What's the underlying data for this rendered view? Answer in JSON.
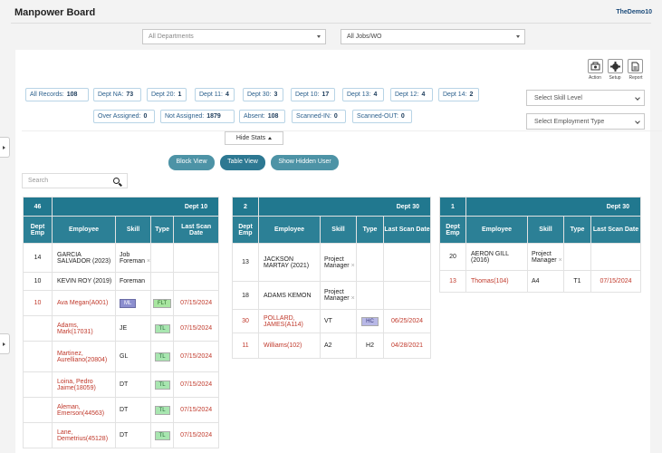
{
  "header": {
    "title": "Manpower Board",
    "user": "TheDemo10"
  },
  "filters": {
    "departments": "All Departments",
    "jobs": "All Jobs/WO"
  },
  "toolbar": {
    "action": "Action",
    "setup": "Setup",
    "report": "Report"
  },
  "stats": [
    {
      "label": "All Records:",
      "value": "108"
    },
    {
      "label": "Dept NA:",
      "value": "73"
    },
    {
      "label": "Dept 20:",
      "value": "1"
    },
    {
      "label": "Dept 11:",
      "value": "4"
    },
    {
      "label": "Dept 30:",
      "value": "3"
    },
    {
      "label": "Dept 10:",
      "value": "17"
    },
    {
      "label": "Dept 13:",
      "value": "4"
    },
    {
      "label": "Dept 12:",
      "value": "4"
    },
    {
      "label": "Dept 14:",
      "value": "2"
    },
    {
      "label": "Over Assigned:",
      "value": "0"
    },
    {
      "label": "Not Assigned:",
      "value": "1879"
    },
    {
      "label": "Absent:",
      "value": "108"
    },
    {
      "label": "Scanned-IN:",
      "value": "0"
    },
    {
      "label": "Scanned-OUT:",
      "value": "0"
    }
  ],
  "skill_level": "Select Skill Level",
  "employment_type": "Select Employment Type",
  "hide_stats": "Hide Stats",
  "views": {
    "block": "Block View",
    "table": "Table View",
    "hidden": "Show Hidden User"
  },
  "search": {
    "placeholder": "Search"
  },
  "columns": {
    "dept_emp": "Dept Emp",
    "employee": "Employee",
    "skill": "Skill",
    "type": "Type",
    "last_scan": "Last Scan Date"
  },
  "tables": [
    {
      "count": "46",
      "dept": "Dept 10",
      "rows": [
        {
          "emp": "14",
          "name": "GARCIA SALVADOR (2023)",
          "skill": "Job Foreman",
          "x": true,
          "type": "",
          "date": "",
          "red": false
        },
        {
          "emp": "10",
          "name": "KEVIN ROY (2019)",
          "skill": "Foreman",
          "x": false,
          "type": "",
          "date": "",
          "red": false
        },
        {
          "emp": "10",
          "name": "Ava Megan(A001)",
          "skill": "ML",
          "skilltag": "ml",
          "type": "FLT",
          "typetag": "ft",
          "date": "07/15/2024",
          "red": true
        },
        {
          "emp": "",
          "name": "Adams, Mark(17031)",
          "skill": "JE",
          "type": "TL",
          "typetag": "tl",
          "date": "07/15/2024",
          "red": true
        },
        {
          "emp": "",
          "name": "Martinez, Aurelliano(20804)",
          "skill": "GL",
          "type": "TL",
          "typetag": "tl",
          "date": "07/15/2024",
          "red": true
        },
        {
          "emp": "",
          "name": "Loina, Pedro Jaime(18059)",
          "skill": "DT",
          "type": "TL",
          "typetag": "tl",
          "date": "07/15/2024",
          "red": true
        },
        {
          "emp": "",
          "name": "Aleman, Emerson(44563)",
          "skill": "DT",
          "type": "TL",
          "typetag": "tl",
          "date": "07/15/2024",
          "red": true
        },
        {
          "emp": "",
          "name": "Lane, Demetrius(45128)",
          "skill": "DT",
          "type": "TL",
          "typetag": "tl",
          "date": "07/15/2024",
          "red": true
        }
      ]
    },
    {
      "count": "2",
      "dept": "Dept 30",
      "rows": [
        {
          "emp": "13",
          "name": "JACKSON MARTAY (2021)",
          "skill": "Project Manager",
          "x": true,
          "type": "",
          "date": "",
          "red": false
        },
        {
          "emp": "18",
          "name": "ADAMS KEMON",
          "skill": "Project Manager",
          "x": true,
          "type": "",
          "date": "",
          "red": false
        },
        {
          "emp": "30",
          "name": "POLLARD, JAMES(A114)",
          "skill": "VT",
          "type": "HC",
          "typetag": "hc",
          "date": "06/25/2024",
          "red": true
        },
        {
          "emp": "11",
          "name": "Williams(102)",
          "skill": "A2",
          "type": "H2",
          "date": "04/28/2021",
          "red": true
        }
      ]
    },
    {
      "count": "1",
      "dept": "Dept 30",
      "rows": [
        {
          "emp": "20",
          "name": "AERON GILL (2016)",
          "skill": "Project Manager",
          "x": true,
          "type": "",
          "date": "",
          "red": false
        },
        {
          "emp": "13",
          "name": "Thomas(104)",
          "skill": "A4",
          "type": "T1",
          "date": "07/15/2024",
          "red": true
        }
      ]
    }
  ]
}
